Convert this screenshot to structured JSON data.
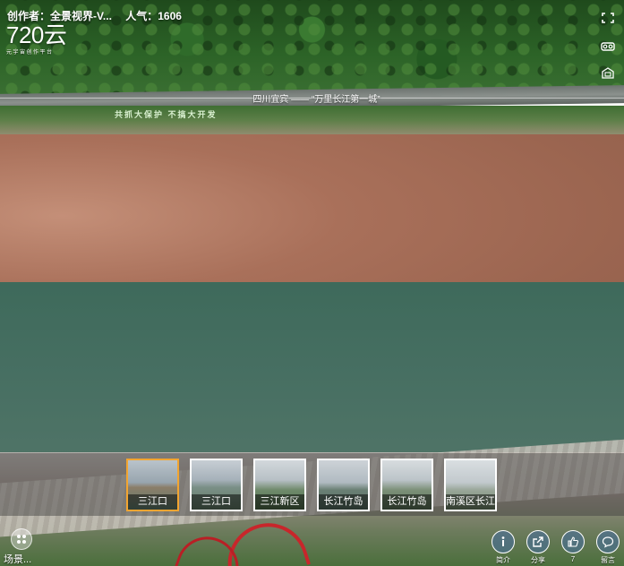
{
  "header": {
    "author_label": "创作者：全景视界-V...",
    "popularity_label": "人气：1606"
  },
  "logo": {
    "main": "720云",
    "sub": "元宇宙创作平台"
  },
  "scene": {
    "title": "四川宜宾 —— “万里长江第一城”",
    "slogan": "共抓大保护  不搞大开发"
  },
  "top_right_icons": [
    "fullscreen-icon",
    "vr-glasses-icon",
    "gyroscope-icon"
  ],
  "thumbnails": [
    {
      "label": "三江口",
      "active": true
    },
    {
      "label": "三江口",
      "active": false
    },
    {
      "label": "三江新区",
      "active": false
    },
    {
      "label": "长江竹岛",
      "active": false
    },
    {
      "label": "长江竹岛",
      "active": false
    },
    {
      "label": "南溪区长江村",
      "active": false
    }
  ],
  "scene_toggle": {
    "label": "场景...",
    "icon": "grid-icon"
  },
  "actions": [
    {
      "name": "intro",
      "icon": "info-icon",
      "label": "简介"
    },
    {
      "name": "share",
      "icon": "share-icon",
      "label": "分享"
    },
    {
      "name": "like",
      "icon": "thumbs-up-icon",
      "label": "7"
    },
    {
      "name": "comment",
      "icon": "comment-icon",
      "label": "留言"
    }
  ],
  "colors": {
    "active_thumb_border": "#f2a531",
    "action_bg": "#466ea0"
  }
}
